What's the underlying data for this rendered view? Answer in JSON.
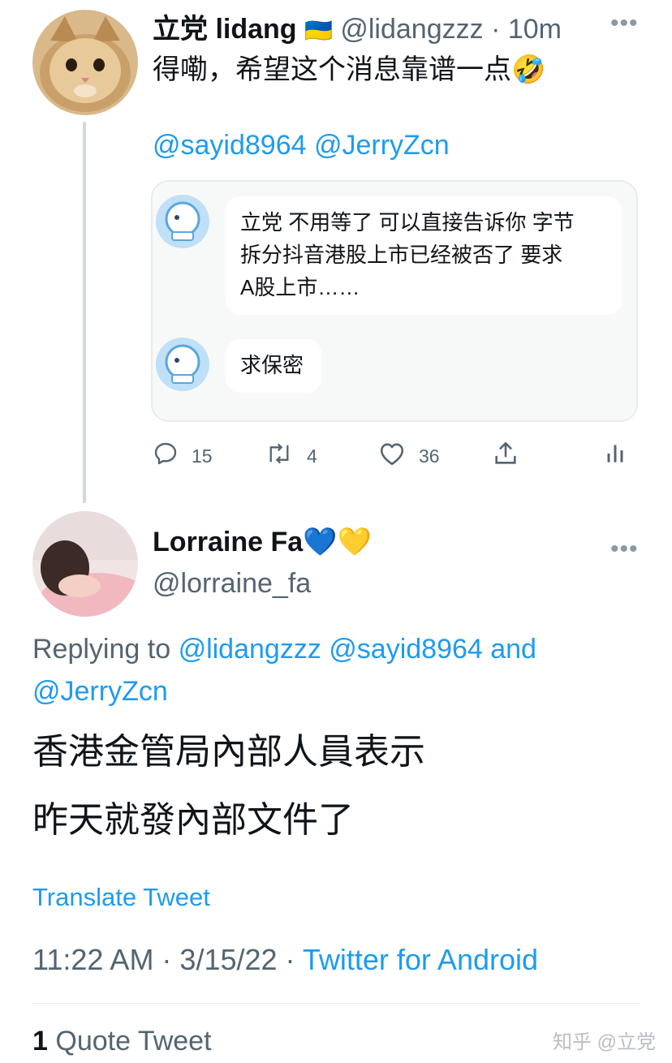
{
  "tweet1": {
    "author_name": "立党 lidang",
    "flag": "🇺🇦",
    "handle": "@lidangzzz",
    "time": "· 10m",
    "more": "•••",
    "text": "得嘞，希望这个消息靠谱一点🤣",
    "mentions": "@sayid8964 @JerryZcn",
    "quoted_messages": [
      {
        "line1": "立党 不用等了 可以直接告诉你 字节",
        "line2": "拆分抖音港股上市已经被否了 要求",
        "line3": "A股上市……"
      },
      {
        "line1": "求保密"
      }
    ],
    "actions": {
      "replies": "15",
      "retweets": "4",
      "likes": "36"
    }
  },
  "tweet2": {
    "author_name": "Lorraine Fa",
    "emoji": "💙💛",
    "handle": "@lorraine_fa",
    "more": "•••",
    "replying_prefix": "Replying to",
    "replying_handles": "@lidangzzz @sayid8964 and @JerryZcn",
    "body_line1": "香港金管局內部人員表示",
    "body_line2": "昨天就發內部文件了",
    "translate": "Translate Tweet",
    "timestamp": "11:22 AM · 3/15/22 ·",
    "source": "Twitter for Android",
    "quote_count": "1",
    "quote_label": "Quote Tweet"
  },
  "watermark": "知乎 @立党",
  "colors": {
    "accent": "#1d9bf0",
    "secondary": "#536471",
    "border": "#e6ecf0"
  }
}
